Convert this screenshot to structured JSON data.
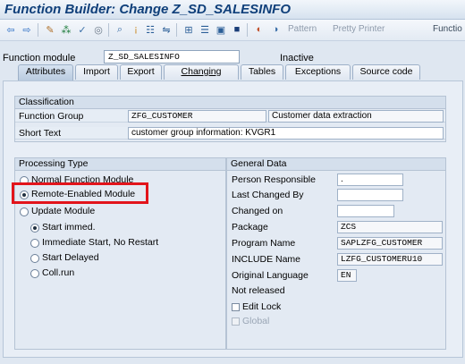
{
  "window": {
    "title": "Function Builder: Change Z_SD_SALESINFO"
  },
  "toolbar": {
    "icons": [
      "back-arrow-icon",
      "forward-arrow-icon",
      "display-change-icon",
      "other-object-icon",
      "check-icon",
      "activate-icon",
      "where-used-icon",
      "info-icon",
      "object-list-icon",
      "navigation-window-icon",
      "enhance-icon",
      "test-icon",
      "display-object-list-icon",
      "help-icon",
      "reference-icon"
    ],
    "pattern": "Pattern",
    "pretty_printer": "Pretty Printer",
    "function": "Functio"
  },
  "header": {
    "label": "Function module",
    "value": "Z_SD_SALESINFO",
    "status": "Inactive"
  },
  "tabs": [
    {
      "label": "Attributes",
      "active": true
    },
    {
      "label": "Import"
    },
    {
      "label": "Export"
    },
    {
      "label": "Changing"
    },
    {
      "label": "Tables"
    },
    {
      "label": "Exceptions"
    },
    {
      "label": "Source code"
    }
  ],
  "classification": {
    "title": "Classification",
    "function_group_label": "Function Group",
    "function_group_value": "ZFG_CUSTOMER",
    "function_group_desc": "Customer data extraction",
    "short_text_label": "Short Text",
    "short_text_value": "customer group information: KVGR1"
  },
  "processing": {
    "title": "Processing Type",
    "options": [
      {
        "label": "Normal Function Module",
        "selected": false
      },
      {
        "label": "Remote-Enabled Module",
        "selected": true
      },
      {
        "label": "Update Module",
        "selected": false
      }
    ],
    "update_options": [
      {
        "label": "Start immed.",
        "selected": true
      },
      {
        "label": "Immediate Start, No Restart",
        "selected": false
      },
      {
        "label": "Start Delayed",
        "selected": false
      },
      {
        "label": "Coll.run",
        "selected": false
      }
    ]
  },
  "general": {
    "title": "General Data",
    "person_label": "Person Responsible",
    "person_value": ".",
    "last_changed_label": "Last Changed By",
    "last_changed_value": "",
    "changed_on_label": "Changed on",
    "changed_on_value": "",
    "package_label": "Package",
    "package_value": "ZCS",
    "program_label": "Program Name",
    "program_value": "SAPLZFG_CUSTOMER",
    "include_label": "INCLUDE Name",
    "include_value": "LZFG_CUSTOMERU10",
    "language_label": "Original Language",
    "language_value": "EN",
    "not_released": "Not released",
    "edit_lock": "Edit Lock",
    "global": "Global"
  },
  "colors": {
    "highlight": "#e2141b",
    "title": "#0f3f7a"
  }
}
